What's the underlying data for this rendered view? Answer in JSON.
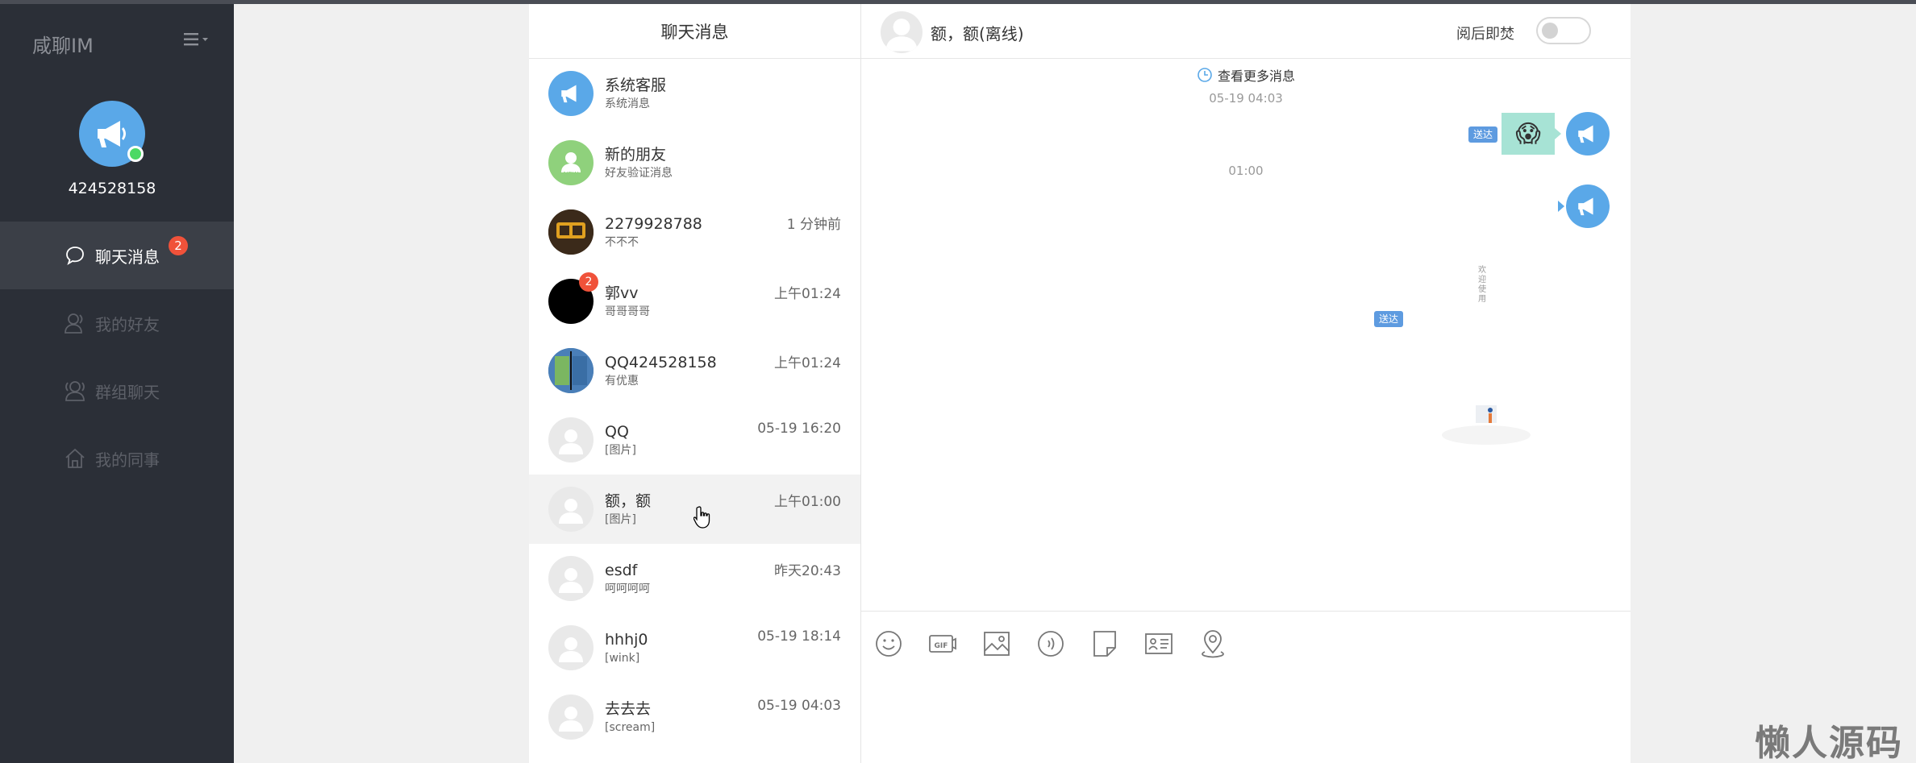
{
  "app": {
    "brand": "咸聊IM"
  },
  "profile": {
    "uid": "424528158"
  },
  "nav": [
    {
      "label": "聊天消息",
      "icon": "chat-bubble-icon",
      "badge": "2"
    },
    {
      "label": "我的好友",
      "icon": "user-icon"
    },
    {
      "label": "群组聊天",
      "icon": "group-icon"
    },
    {
      "label": "我的同事",
      "icon": "home-icon"
    }
  ],
  "chat_list": {
    "title": "聊天消息",
    "items": [
      {
        "name": "系统客服",
        "preview": "系统消息",
        "time": ""
      },
      {
        "name": "新的朋友",
        "preview": "好友验证消息",
        "time": ""
      },
      {
        "name": "2279928788",
        "preview": "不不不",
        "time": "1 分钟前"
      },
      {
        "name": "郭vv",
        "preview": "哥哥哥哥",
        "time": "上午01:24",
        "badge": "2"
      },
      {
        "name": "QQ424528158",
        "preview": "有优惠",
        "time": "上午01:24"
      },
      {
        "name": "QQ",
        "preview": "[图片]",
        "time": "05-19 16:20"
      },
      {
        "name": "额，额",
        "preview": "[图片]",
        "time": "上午01:00"
      },
      {
        "name": "esdf",
        "preview": "呵呵呵呵",
        "time": "昨天20:43"
      },
      {
        "name": "hhhj0",
        "preview": "[wink]",
        "time": "05-19 18:14"
      },
      {
        "name": "去去去",
        "preview": "[scream]",
        "time": "05-19 04:03"
      }
    ]
  },
  "chat": {
    "title": "额，额(离线)",
    "burn_label": "阅后即焚",
    "burn_enabled": false,
    "more_messages": "查看更多消息",
    "timestamp_1": "05-19 04:03",
    "timestamp_2": "01:00",
    "sent_label_1": "送达",
    "sent_label_2": "送达",
    "vertical_text": "欢迎使用",
    "emoji": "😱"
  },
  "toolbar": {
    "icons": [
      "smile-icon",
      "gif-icon",
      "image-icon",
      "audio-icon",
      "file-icon",
      "card-icon",
      "location-icon"
    ]
  },
  "watermark": "懒人源码",
  "colors": {
    "sidebar": "#2b2f37",
    "accent": "#5aa8e8",
    "badge": "#f0523a",
    "online": "#4cd964"
  }
}
